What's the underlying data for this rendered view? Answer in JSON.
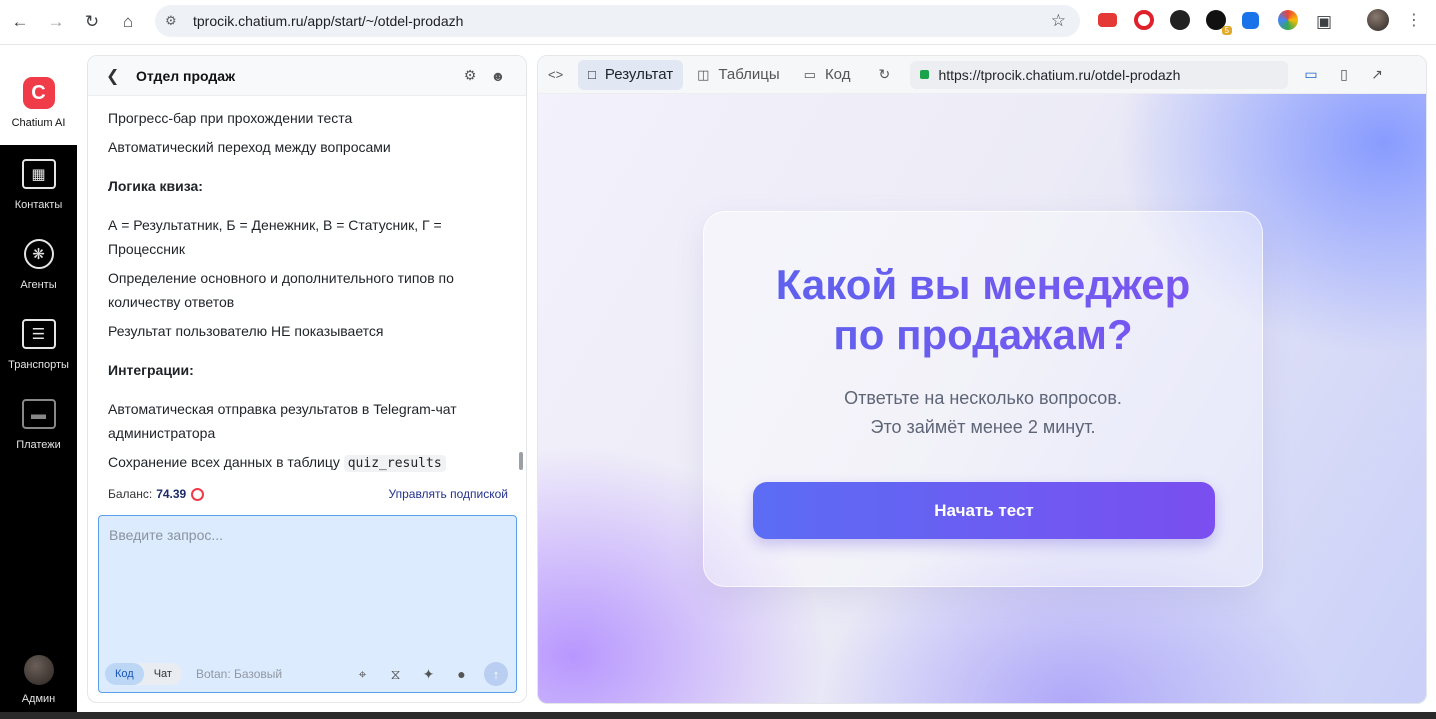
{
  "browser": {
    "url": "tprocik.chatium.ru/app/start/~/otdel-prodazh",
    "extension_badge": "5"
  },
  "rail": {
    "brand": "Chatium AI",
    "items": [
      {
        "label": "Контакты",
        "icon": "contacts-icon"
      },
      {
        "label": "Агенты",
        "icon": "brain-icon"
      },
      {
        "label": "Транспорты",
        "icon": "transport-icon"
      },
      {
        "label": "Платежи",
        "icon": "payments-icon"
      }
    ],
    "user_label": "Админ"
  },
  "chat": {
    "title": "Отдел продаж",
    "lines": {
      "l1": "Прогресс-бар при прохождении теста",
      "l2": "Автоматический переход между вопросами",
      "h1": "Логика квиза:",
      "l3": "А = Результатник, Б = Денежник, В = Статусник, Г = Процессник",
      "l4": "Определение основного и дополнительного типов по количеству ответов",
      "l5": "Результат пользователю НЕ показывается",
      "h2": "Интеграции:",
      "l6": "Автоматическая отправка результатов в Telegram-чат администратора",
      "l7_prefix": "Сохранение всех данных в таблицу",
      "l7_code": "quiz_results"
    },
    "balance_label": "Баланс:",
    "balance_value": "74.39",
    "manage_label": "Управлять подпиской",
    "input_placeholder": "Введите запрос...",
    "mode_code": "Код",
    "mode_chat": "Чат",
    "model_label": "Botan: Базовый"
  },
  "preview": {
    "tabs": [
      {
        "label": "Результат",
        "icon": "window-icon",
        "active": true
      },
      {
        "label": "Таблицы",
        "icon": "database-icon",
        "active": false
      },
      {
        "label": "Код",
        "icon": "folder-icon",
        "active": false
      }
    ],
    "url": "https://tprocik.chatium.ru/otdel-prodazh",
    "page": {
      "title_line1": "Какой вы менеджер",
      "title_line2": "по продажам?",
      "sub_line1": "Ответьте на несколько вопросов.",
      "sub_line2": "Это займёт менее 2 минут.",
      "cta": "Начать тест"
    }
  },
  "colors": {
    "brand_red": "#ef3c48",
    "accent_blue": "#5b6df4",
    "accent_violet": "#7a4ef0",
    "rail_bg": "#000000"
  }
}
